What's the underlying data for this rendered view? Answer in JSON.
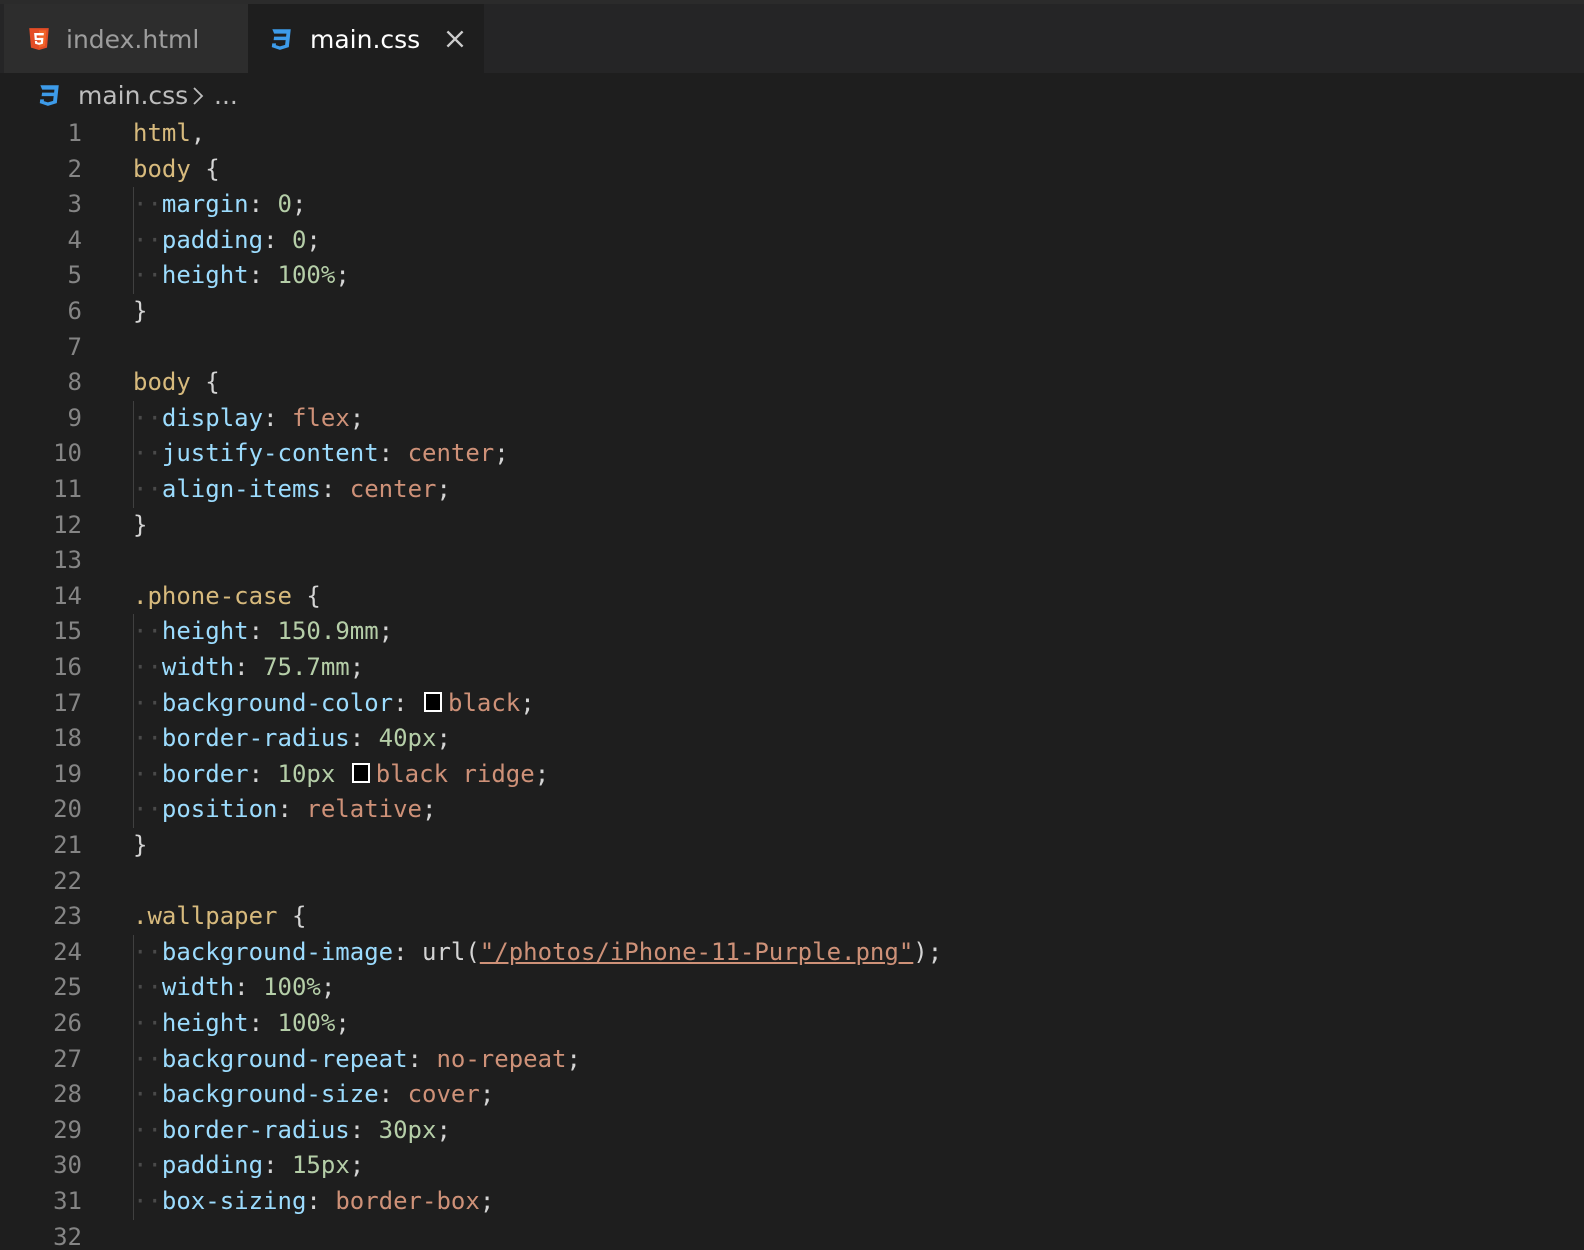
{
  "tabs": [
    {
      "label": "index.html",
      "icon": "html5-icon",
      "active": false
    },
    {
      "label": "main.css",
      "icon": "css3-icon",
      "active": true
    }
  ],
  "breadcrumb": {
    "file": "main.css",
    "rest": "..."
  },
  "colors": {
    "background": "#1e1e1e",
    "selector": "#d7ba7d",
    "property": "#9cdcfe",
    "number": "#b5cea8",
    "keyword": "#ce9178",
    "html_icon": "#e44d26",
    "css_icon": "#3d9be9"
  },
  "code_lines": [
    [
      {
        "t": "sel",
        "v": "html"
      },
      {
        "t": "punc",
        "v": ","
      }
    ],
    [
      {
        "t": "sel",
        "v": "body"
      },
      {
        "t": "punc",
        "v": " {"
      }
    ],
    [
      {
        "t": "prop",
        "v": "margin"
      },
      {
        "t": "punc",
        "v": ": "
      },
      {
        "t": "num",
        "v": "0"
      },
      {
        "t": "punc",
        "v": ";"
      }
    ],
    [
      {
        "t": "prop",
        "v": "padding"
      },
      {
        "t": "punc",
        "v": ": "
      },
      {
        "t": "num",
        "v": "0"
      },
      {
        "t": "punc",
        "v": ";"
      }
    ],
    [
      {
        "t": "prop",
        "v": "height"
      },
      {
        "t": "punc",
        "v": ": "
      },
      {
        "t": "num",
        "v": "100%"
      },
      {
        "t": "punc",
        "v": ";"
      }
    ],
    [
      {
        "t": "punc",
        "v": "}"
      }
    ],
    [],
    [
      {
        "t": "sel",
        "v": "body"
      },
      {
        "t": "punc",
        "v": " {"
      }
    ],
    [
      {
        "t": "prop",
        "v": "display"
      },
      {
        "t": "punc",
        "v": ": "
      },
      {
        "t": "kw",
        "v": "flex"
      },
      {
        "t": "punc",
        "v": ";"
      }
    ],
    [
      {
        "t": "prop",
        "v": "justify-content"
      },
      {
        "t": "punc",
        "v": ": "
      },
      {
        "t": "kw",
        "v": "center"
      },
      {
        "t": "punc",
        "v": ";"
      }
    ],
    [
      {
        "t": "prop",
        "v": "align-items"
      },
      {
        "t": "punc",
        "v": ": "
      },
      {
        "t": "kw",
        "v": "center"
      },
      {
        "t": "punc",
        "v": ";"
      }
    ],
    [
      {
        "t": "punc",
        "v": "}"
      }
    ],
    [],
    [
      {
        "t": "sel",
        "v": ".phone-case"
      },
      {
        "t": "punc",
        "v": " {"
      }
    ],
    [
      {
        "t": "prop",
        "v": "height"
      },
      {
        "t": "punc",
        "v": ": "
      },
      {
        "t": "num",
        "v": "150.9mm"
      },
      {
        "t": "punc",
        "v": ";"
      }
    ],
    [
      {
        "t": "prop",
        "v": "width"
      },
      {
        "t": "punc",
        "v": ": "
      },
      {
        "t": "num",
        "v": "75.7mm"
      },
      {
        "t": "punc",
        "v": ";"
      }
    ],
    [
      {
        "t": "prop",
        "v": "background-color"
      },
      {
        "t": "punc",
        "v": ": "
      },
      {
        "t": "swatch",
        "v": ""
      },
      {
        "t": "kw",
        "v": "black"
      },
      {
        "t": "punc",
        "v": ";"
      }
    ],
    [
      {
        "t": "prop",
        "v": "border-radius"
      },
      {
        "t": "punc",
        "v": ": "
      },
      {
        "t": "num",
        "v": "40px"
      },
      {
        "t": "punc",
        "v": ";"
      }
    ],
    [
      {
        "t": "prop",
        "v": "border"
      },
      {
        "t": "punc",
        "v": ": "
      },
      {
        "t": "num",
        "v": "10px"
      },
      {
        "t": "punc",
        "v": " "
      },
      {
        "t": "swatch",
        "v": ""
      },
      {
        "t": "kw",
        "v": "black ridge"
      },
      {
        "t": "punc",
        "v": ";"
      }
    ],
    [
      {
        "t": "prop",
        "v": "position"
      },
      {
        "t": "punc",
        "v": ": "
      },
      {
        "t": "kw",
        "v": "relative"
      },
      {
        "t": "punc",
        "v": ";"
      }
    ],
    [
      {
        "t": "punc",
        "v": "}"
      }
    ],
    [],
    [
      {
        "t": "sel",
        "v": ".wallpaper"
      },
      {
        "t": "punc",
        "v": " {"
      }
    ],
    [
      {
        "t": "prop",
        "v": "background-image"
      },
      {
        "t": "punc",
        "v": ": "
      },
      {
        "t": "fn",
        "v": "url("
      },
      {
        "t": "str",
        "v": "\"/photos/iPhone-11-Purple.png\""
      },
      {
        "t": "punc",
        "v": ");"
      }
    ],
    [
      {
        "t": "prop",
        "v": "width"
      },
      {
        "t": "punc",
        "v": ": "
      },
      {
        "t": "num",
        "v": "100%"
      },
      {
        "t": "punc",
        "v": ";"
      }
    ],
    [
      {
        "t": "prop",
        "v": "height"
      },
      {
        "t": "punc",
        "v": ": "
      },
      {
        "t": "num",
        "v": "100%"
      },
      {
        "t": "punc",
        "v": ";"
      }
    ],
    [
      {
        "t": "prop",
        "v": "background-repeat"
      },
      {
        "t": "punc",
        "v": ": "
      },
      {
        "t": "kw",
        "v": "no-repeat"
      },
      {
        "t": "punc",
        "v": ";"
      }
    ],
    [
      {
        "t": "prop",
        "v": "background-size"
      },
      {
        "t": "punc",
        "v": ": "
      },
      {
        "t": "kw",
        "v": "cover"
      },
      {
        "t": "punc",
        "v": ";"
      }
    ],
    [
      {
        "t": "prop",
        "v": "border-radius"
      },
      {
        "t": "punc",
        "v": ": "
      },
      {
        "t": "num",
        "v": "30px"
      },
      {
        "t": "punc",
        "v": ";"
      }
    ],
    [
      {
        "t": "prop",
        "v": "padding"
      },
      {
        "t": "punc",
        "v": ": "
      },
      {
        "t": "num",
        "v": "15px"
      },
      {
        "t": "punc",
        "v": ";"
      }
    ],
    [
      {
        "t": "prop",
        "v": "box-sizing"
      },
      {
        "t": "punc",
        "v": ": "
      },
      {
        "t": "kw",
        "v": "border-box"
      },
      {
        "t": "punc",
        "v": ";"
      }
    ],
    []
  ],
  "line_numbers": [
    "1",
    "2",
    "3",
    "4",
    "5",
    "6",
    "7",
    "8",
    "9",
    "10",
    "11",
    "12",
    "13",
    "14",
    "15",
    "16",
    "17",
    "18",
    "19",
    "20",
    "21",
    "22",
    "23",
    "24",
    "25",
    "26",
    "27",
    "28",
    "29",
    "30",
    "31",
    "32"
  ]
}
